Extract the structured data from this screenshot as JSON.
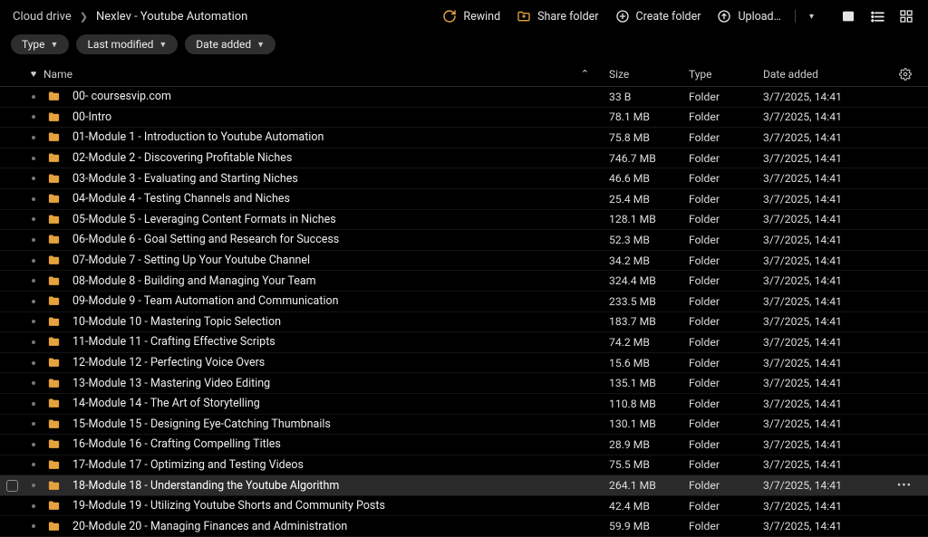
{
  "breadcrumbs": [
    "Cloud drive",
    "Nexlev - Youtube Automation"
  ],
  "topbar": {
    "rewind": "Rewind",
    "share": "Share folder",
    "create": "Create folder",
    "upload": "Upload…"
  },
  "chips": {
    "type": "Type",
    "lastmod": "Last modified",
    "dateadded": "Date added"
  },
  "columns": {
    "name": "Name",
    "size": "Size",
    "type": "Type",
    "date": "Date added"
  },
  "commonDate": "3/7/2025, 14:41",
  "folderType": "Folder",
  "rows": [
    {
      "name": "00- coursesvip.com",
      "size": "33 B"
    },
    {
      "name": "00-Intro",
      "size": "78.1 MB"
    },
    {
      "name": "01-Module 1 - Introduction to Youtube Automation",
      "size": "75.8 MB"
    },
    {
      "name": "02-Module 2 - Discovering Profitable Niches",
      "size": "746.7 MB"
    },
    {
      "name": "03-Module 3 - Evaluating and Starting Niches",
      "size": "46.6 MB"
    },
    {
      "name": "04-Module 4 - Testing Channels and Niches",
      "size": "25.4 MB"
    },
    {
      "name": "05-Module 5 - Leveraging Content Formats in Niches",
      "size": "128.1 MB"
    },
    {
      "name": "06-Module 6 - Goal Setting and Research for Success",
      "size": "52.3 MB"
    },
    {
      "name": "07-Module 7 - Setting Up Your Youtube Channel",
      "size": "34.2 MB"
    },
    {
      "name": "08-Module 8 - Building and Managing Your Team",
      "size": "324.4 MB"
    },
    {
      "name": "09-Module 9 - Team Automation and Communication",
      "size": "233.5 MB"
    },
    {
      "name": "10-Module 10 - Mastering Topic Selection",
      "size": "183.7 MB"
    },
    {
      "name": "11-Module 11 - Crafting Effective Scripts",
      "size": "74.2 MB"
    },
    {
      "name": "12-Module 12 - Perfecting Voice Overs",
      "size": "15.6 MB"
    },
    {
      "name": "13-Module 13 - Mastering Video Editing",
      "size": "135.1 MB"
    },
    {
      "name": "14-Module 14 - The Art of Storytelling",
      "size": "110.8 MB"
    },
    {
      "name": "15-Module 15 - Designing Eye-Catching Thumbnails",
      "size": "130.1 MB"
    },
    {
      "name": "16-Module 16 - Crafting Compelling Titles",
      "size": "28.9 MB"
    },
    {
      "name": "17-Module 17 - Optimizing and Testing Videos",
      "size": "75.5 MB"
    },
    {
      "name": "18-Module 18 - Understanding the Youtube Algorithm",
      "size": "264.1 MB",
      "hover": true
    },
    {
      "name": "19-Module 19 - Utilizing Youtube Shorts and Community Posts",
      "size": "42.4 MB"
    },
    {
      "name": "20-Module 20 - Managing Finances and Administration",
      "size": "59.9 MB"
    }
  ]
}
